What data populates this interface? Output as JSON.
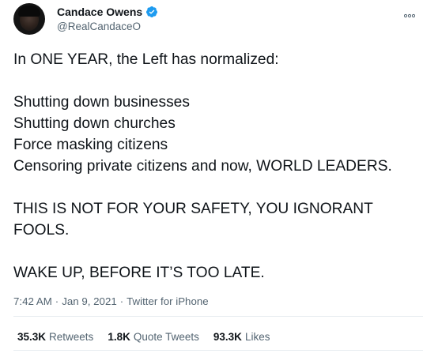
{
  "author": {
    "display_name": "Candace Owens",
    "handle": "@RealCandaceO",
    "verified_icon": "verified-badge-icon",
    "avatar_icon": "profile-photo"
  },
  "tweet": {
    "text": "In ONE YEAR, the Left has normalized:\n\nShutting down businesses\nShutting down churches\nForce masking citizens\nCensoring private citizens and now, WORLD LEADERS.\n\nTHIS IS NOT FOR YOUR SAFETY, YOU IGNORANT FOOLS.\n\nWAKE UP, BEFORE IT’S TOO LATE."
  },
  "meta": {
    "time": "7:42 AM",
    "separator": "·",
    "date": "Jan 9, 2021",
    "source": "Twitter for iPhone"
  },
  "stats": {
    "retweets_count": "35.3K",
    "retweets_label": "Retweets",
    "quotes_count": "1.8K",
    "quotes_label": "Quote Tweets",
    "likes_count": "93.3K",
    "likes_label": "Likes"
  },
  "colors": {
    "text": "#0f1419",
    "secondary": "#536471",
    "verified": "#1d9bf0",
    "divider": "#e6ecf0"
  },
  "icons": {
    "more": "more-options-icon"
  }
}
